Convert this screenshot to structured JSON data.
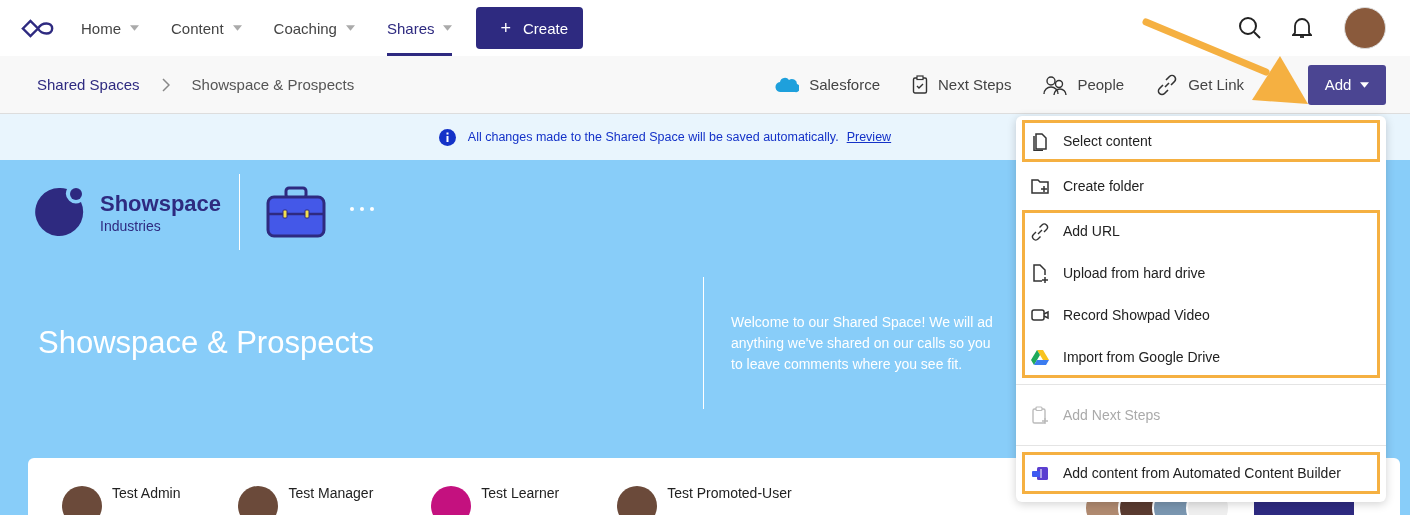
{
  "nav": {
    "items": [
      {
        "label": "Home",
        "selected": false
      },
      {
        "label": "Content",
        "selected": false
      },
      {
        "label": "Coaching",
        "selected": false
      },
      {
        "label": "Shares",
        "selected": true
      }
    ],
    "create_button": {
      "icon": "+",
      "label": "Create"
    }
  },
  "breadcrumbs": [
    {
      "label": "Shared Spaces",
      "kind": "link"
    },
    {
      "label": "Showspace & Prospects",
      "kind": "current"
    }
  ],
  "toolbar": {
    "actions": [
      {
        "label": "Salesforce",
        "kind": "cloud"
      },
      {
        "label": "Next Steps",
        "kind": "clipboard"
      },
      {
        "label": "People",
        "kind": "people"
      },
      {
        "label": "Get Link",
        "kind": "link"
      }
    ],
    "add_button": "Add"
  },
  "banner": {
    "message": "All changes made to the Shared Space will be saved automatically.",
    "link": "Preview"
  },
  "hero": {
    "brand_name": "Showspace",
    "brand_sub": "Industries",
    "title": "Showspace & Prospects",
    "welcome_lines": [
      "Welcome to our Shared Space! We will ad",
      "anything we've shared on our calls so you",
      "to leave comments where you see fit."
    ]
  },
  "people": [
    {
      "name": "Test Admin",
      "kind": "photo"
    },
    {
      "name": "Test Manager",
      "kind": "photo"
    },
    {
      "name": "Test Learner",
      "kind": "initials",
      "color": "#c4117f"
    },
    {
      "name": "Test Promoted-User",
      "kind": "photo"
    }
  ],
  "menu": {
    "sections": [
      {
        "groups": [
          {
            "highlighted": true,
            "items": [
              {
                "label": "Select content",
                "kind": "file",
                "disabled": false
              }
            ]
          },
          {
            "highlighted": false,
            "items": [
              {
                "label": "Create folder",
                "kind": "folder",
                "disabled": false
              }
            ]
          },
          {
            "highlighted": true,
            "items": [
              {
                "label": "Add URL",
                "kind": "link",
                "disabled": false
              },
              {
                "label": "Upload from hard drive",
                "kind": "upload",
                "disabled": false
              },
              {
                "label": "Record Showpad Video",
                "kind": "video",
                "disabled": false
              },
              {
                "label": "Import from Google Drive",
                "kind": "drive",
                "disabled": false
              }
            ]
          }
        ]
      },
      {
        "groups": [
          {
            "highlighted": false,
            "items": [
              {
                "label": "Add Next Steps",
                "kind": "clipboard",
                "disabled": true
              }
            ]
          }
        ]
      },
      {
        "groups": [
          {
            "highlighted": true,
            "items": [
              {
                "label": "Add content from Automated Content Builder",
                "kind": "builder",
                "disabled": false
              }
            ]
          }
        ]
      }
    ]
  }
}
